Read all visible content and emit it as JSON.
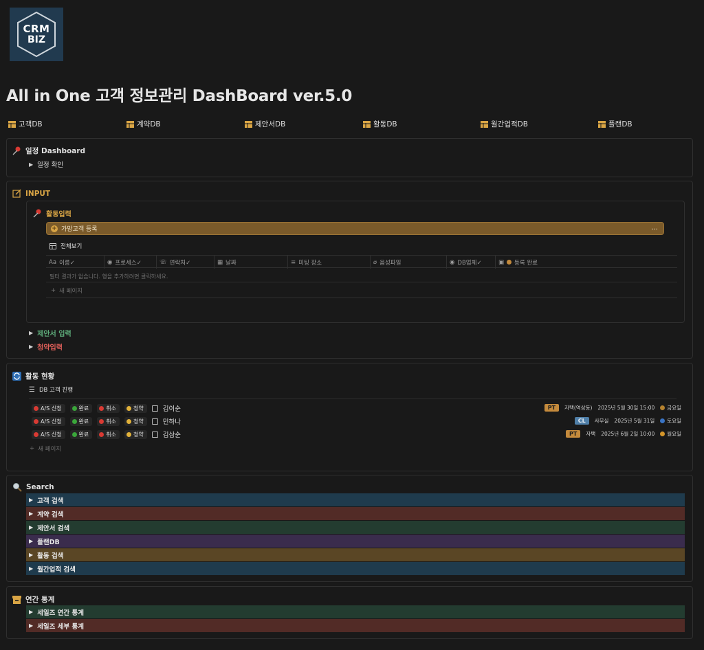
{
  "logo": {
    "line1": "CRM",
    "line2": "BIZ"
  },
  "title": "All in One 고객 정보관리 DashBoard ver.5.0",
  "db_links": [
    "고객DB",
    "계약DB",
    "제안서DB",
    "활동DB",
    "월간업적DB",
    "플랜DB"
  ],
  "schedule": {
    "title": "일정 Dashboard",
    "toggle": "일정 확인"
  },
  "input": {
    "title": "INPUT",
    "activity_title": "활동입력",
    "add_button": "가망고객 등록",
    "more": "...",
    "view_label": "전체보기",
    "columns": [
      {
        "prefix": "Aa",
        "label": "이름✓"
      },
      {
        "prefix": "◉",
        "label": "프로세스✓"
      },
      {
        "prefix": "☏",
        "label": "연락처✓"
      },
      {
        "prefix": "▦",
        "label": "날짜"
      },
      {
        "prefix": "≡",
        "label": "미팅 장소"
      },
      {
        "prefix": "⌀",
        "label": "음성파일"
      },
      {
        "prefix": "◉",
        "label": "DB업체✓"
      },
      {
        "prefix": "▣",
        "label": "등록 완료"
      }
    ],
    "empty_message": "필터 결과가 없습니다. 행을 추가하려면 클릭하세요.",
    "new_page": "새 페이지",
    "proposal_toggle": "제안서 입력",
    "contract_toggle": "청약입력"
  },
  "activity": {
    "title": "활동 현황",
    "view_label": "DB 고객 진행",
    "tags": [
      "A/S 신청",
      "완료",
      "취소",
      "청약"
    ],
    "tag_colors": [
      "#d93a33",
      "#3aa63a",
      "#d93a33",
      "#e2b23a"
    ],
    "rows": [
      {
        "name": "김이순",
        "badge": "PT",
        "badge_color": "#c48a3c",
        "place": "자택(역삼동)",
        "date": "2025년 5월 30일 15:00",
        "day_color": "#b5822f",
        "day": "금요일"
      },
      {
        "name": "민하나",
        "badge": "CL",
        "badge_color": "#5a8ab5",
        "place": "사무실",
        "date": "2025년 5월 31일",
        "day_color": "#3a74c4",
        "day": "토요일"
      },
      {
        "name": "김삼순",
        "badge": "PT",
        "badge_color": "#c48a3c",
        "place": "자택",
        "date": "2025년 6월 2일 10:00",
        "day_color": "#d4952a",
        "day": "월요일"
      }
    ],
    "new_page": "새 페이지"
  },
  "search": {
    "title": "Search",
    "items": [
      {
        "label": "고객 검색",
        "color": "#1f3b4d"
      },
      {
        "label": "계약 검색",
        "color": "#522b26"
      },
      {
        "label": "제안서 검색",
        "color": "#233c30"
      },
      {
        "label": "플랜DB",
        "color": "#3a2c4d"
      },
      {
        "label": "활동 검색",
        "color": "#5a4625"
      },
      {
        "label": "월간업적 검색",
        "color": "#1f3b4d"
      }
    ]
  },
  "stats": {
    "title": "연간 통계",
    "items": [
      {
        "label": "세일즈 연간 통계",
        "color": "#233c30"
      },
      {
        "label": "세일즈 세부 통계",
        "color": "#522b26"
      }
    ]
  }
}
